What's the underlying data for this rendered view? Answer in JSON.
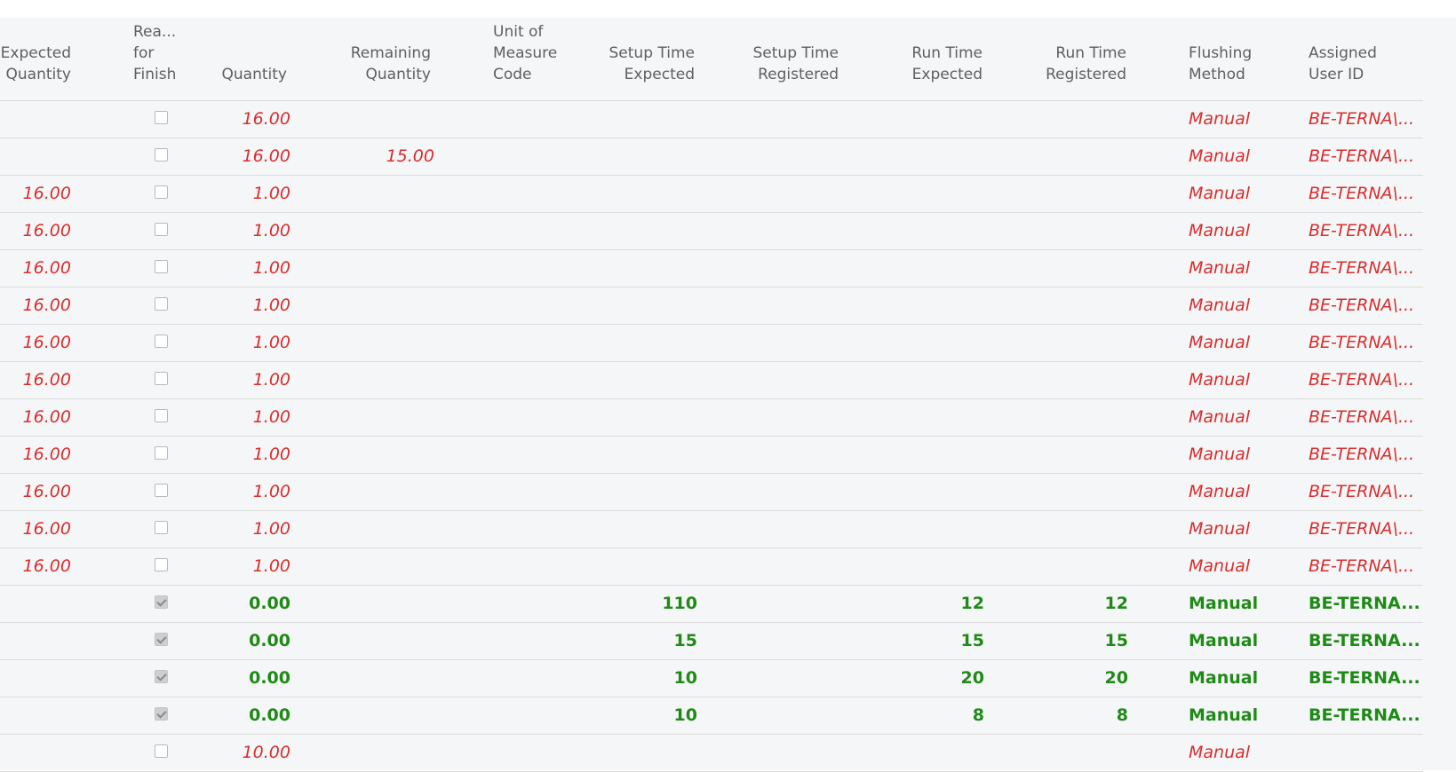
{
  "headers": {
    "expected_quantity": "Expected\nQuantity",
    "ready_for_finish": "Rea...\nfor\nFinish",
    "quantity": "Quantity",
    "remaining_quantity": "Remaining\nQuantity",
    "unit_of_measure_code": "Unit of\nMeasure\nCode",
    "setup_time_expected": "Setup Time\nExpected",
    "setup_time_registered": "Setup Time\nRegistered",
    "run_time_expected": "Run Time\nExpected",
    "run_time_registered": "Run Time\nRegistered",
    "flushing_method": "Flushing\nMethod",
    "assigned_user_id": "Assigned\nUser ID"
  },
  "rows": [
    {
      "style": "red",
      "expected_quantity": "",
      "ready": false,
      "quantity": "16.00",
      "remaining_quantity": "",
      "setup_time_expected": "",
      "run_time_expected": "",
      "run_time_registered": "",
      "flushing_method": "Manual",
      "assigned_user_id": "BE-TERNA\\..."
    },
    {
      "style": "red",
      "expected_quantity": "",
      "ready": false,
      "quantity": "16.00",
      "remaining_quantity": "15.00",
      "setup_time_expected": "",
      "run_time_expected": "",
      "run_time_registered": "",
      "flushing_method": "Manual",
      "assigned_user_id": "BE-TERNA\\..."
    },
    {
      "style": "red",
      "expected_quantity": "16.00",
      "ready": false,
      "quantity": "1.00",
      "remaining_quantity": "",
      "setup_time_expected": "",
      "run_time_expected": "",
      "run_time_registered": "",
      "flushing_method": "Manual",
      "assigned_user_id": "BE-TERNA\\..."
    },
    {
      "style": "red",
      "expected_quantity": "16.00",
      "ready": false,
      "quantity": "1.00",
      "remaining_quantity": "",
      "setup_time_expected": "",
      "run_time_expected": "",
      "run_time_registered": "",
      "flushing_method": "Manual",
      "assigned_user_id": "BE-TERNA\\..."
    },
    {
      "style": "red",
      "expected_quantity": "16.00",
      "ready": false,
      "quantity": "1.00",
      "remaining_quantity": "",
      "setup_time_expected": "",
      "run_time_expected": "",
      "run_time_registered": "",
      "flushing_method": "Manual",
      "assigned_user_id": "BE-TERNA\\..."
    },
    {
      "style": "red",
      "expected_quantity": "16.00",
      "ready": false,
      "quantity": "1.00",
      "remaining_quantity": "",
      "setup_time_expected": "",
      "run_time_expected": "",
      "run_time_registered": "",
      "flushing_method": "Manual",
      "assigned_user_id": "BE-TERNA\\..."
    },
    {
      "style": "red",
      "expected_quantity": "16.00",
      "ready": false,
      "quantity": "1.00",
      "remaining_quantity": "",
      "setup_time_expected": "",
      "run_time_expected": "",
      "run_time_registered": "",
      "flushing_method": "Manual",
      "assigned_user_id": "BE-TERNA\\..."
    },
    {
      "style": "red",
      "expected_quantity": "16.00",
      "ready": false,
      "quantity": "1.00",
      "remaining_quantity": "",
      "setup_time_expected": "",
      "run_time_expected": "",
      "run_time_registered": "",
      "flushing_method": "Manual",
      "assigned_user_id": "BE-TERNA\\..."
    },
    {
      "style": "red",
      "expected_quantity": "16.00",
      "ready": false,
      "quantity": "1.00",
      "remaining_quantity": "",
      "setup_time_expected": "",
      "run_time_expected": "",
      "run_time_registered": "",
      "flushing_method": "Manual",
      "assigned_user_id": "BE-TERNA\\..."
    },
    {
      "style": "red",
      "expected_quantity": "16.00",
      "ready": false,
      "quantity": "1.00",
      "remaining_quantity": "",
      "setup_time_expected": "",
      "run_time_expected": "",
      "run_time_registered": "",
      "flushing_method": "Manual",
      "assigned_user_id": "BE-TERNA\\..."
    },
    {
      "style": "red",
      "expected_quantity": "16.00",
      "ready": false,
      "quantity": "1.00",
      "remaining_quantity": "",
      "setup_time_expected": "",
      "run_time_expected": "",
      "run_time_registered": "",
      "flushing_method": "Manual",
      "assigned_user_id": "BE-TERNA\\..."
    },
    {
      "style": "red",
      "expected_quantity": "16.00",
      "ready": false,
      "quantity": "1.00",
      "remaining_quantity": "",
      "setup_time_expected": "",
      "run_time_expected": "",
      "run_time_registered": "",
      "flushing_method": "Manual",
      "assigned_user_id": "BE-TERNA\\..."
    },
    {
      "style": "red",
      "expected_quantity": "16.00",
      "ready": false,
      "quantity": "1.00",
      "remaining_quantity": "",
      "setup_time_expected": "",
      "run_time_expected": "",
      "run_time_registered": "",
      "flushing_method": "Manual",
      "assigned_user_id": "BE-TERNA\\..."
    },
    {
      "style": "green",
      "expected_quantity": "",
      "ready": true,
      "quantity": "0.00",
      "remaining_quantity": "",
      "setup_time_expected": "110",
      "run_time_expected": "12",
      "run_time_registered": "12",
      "flushing_method": "Manual",
      "assigned_user_id": "BE-TERNA..."
    },
    {
      "style": "green",
      "expected_quantity": "",
      "ready": true,
      "quantity": "0.00",
      "remaining_quantity": "",
      "setup_time_expected": "15",
      "run_time_expected": "15",
      "run_time_registered": "15",
      "flushing_method": "Manual",
      "assigned_user_id": "BE-TERNA..."
    },
    {
      "style": "green",
      "expected_quantity": "",
      "ready": true,
      "quantity": "0.00",
      "remaining_quantity": "",
      "setup_time_expected": "10",
      "run_time_expected": "20",
      "run_time_registered": "20",
      "flushing_method": "Manual",
      "assigned_user_id": "BE-TERNA..."
    },
    {
      "style": "green",
      "expected_quantity": "",
      "ready": true,
      "quantity": "0.00",
      "remaining_quantity": "",
      "setup_time_expected": "10",
      "run_time_expected": "8",
      "run_time_registered": "8",
      "flushing_method": "Manual",
      "assigned_user_id": "BE-TERNA..."
    },
    {
      "style": "red",
      "expected_quantity": "",
      "ready": false,
      "quantity": "10.00",
      "remaining_quantity": "",
      "setup_time_expected": "",
      "run_time_expected": "",
      "run_time_registered": "",
      "flushing_method": "Manual",
      "assigned_user_id": ""
    }
  ]
}
